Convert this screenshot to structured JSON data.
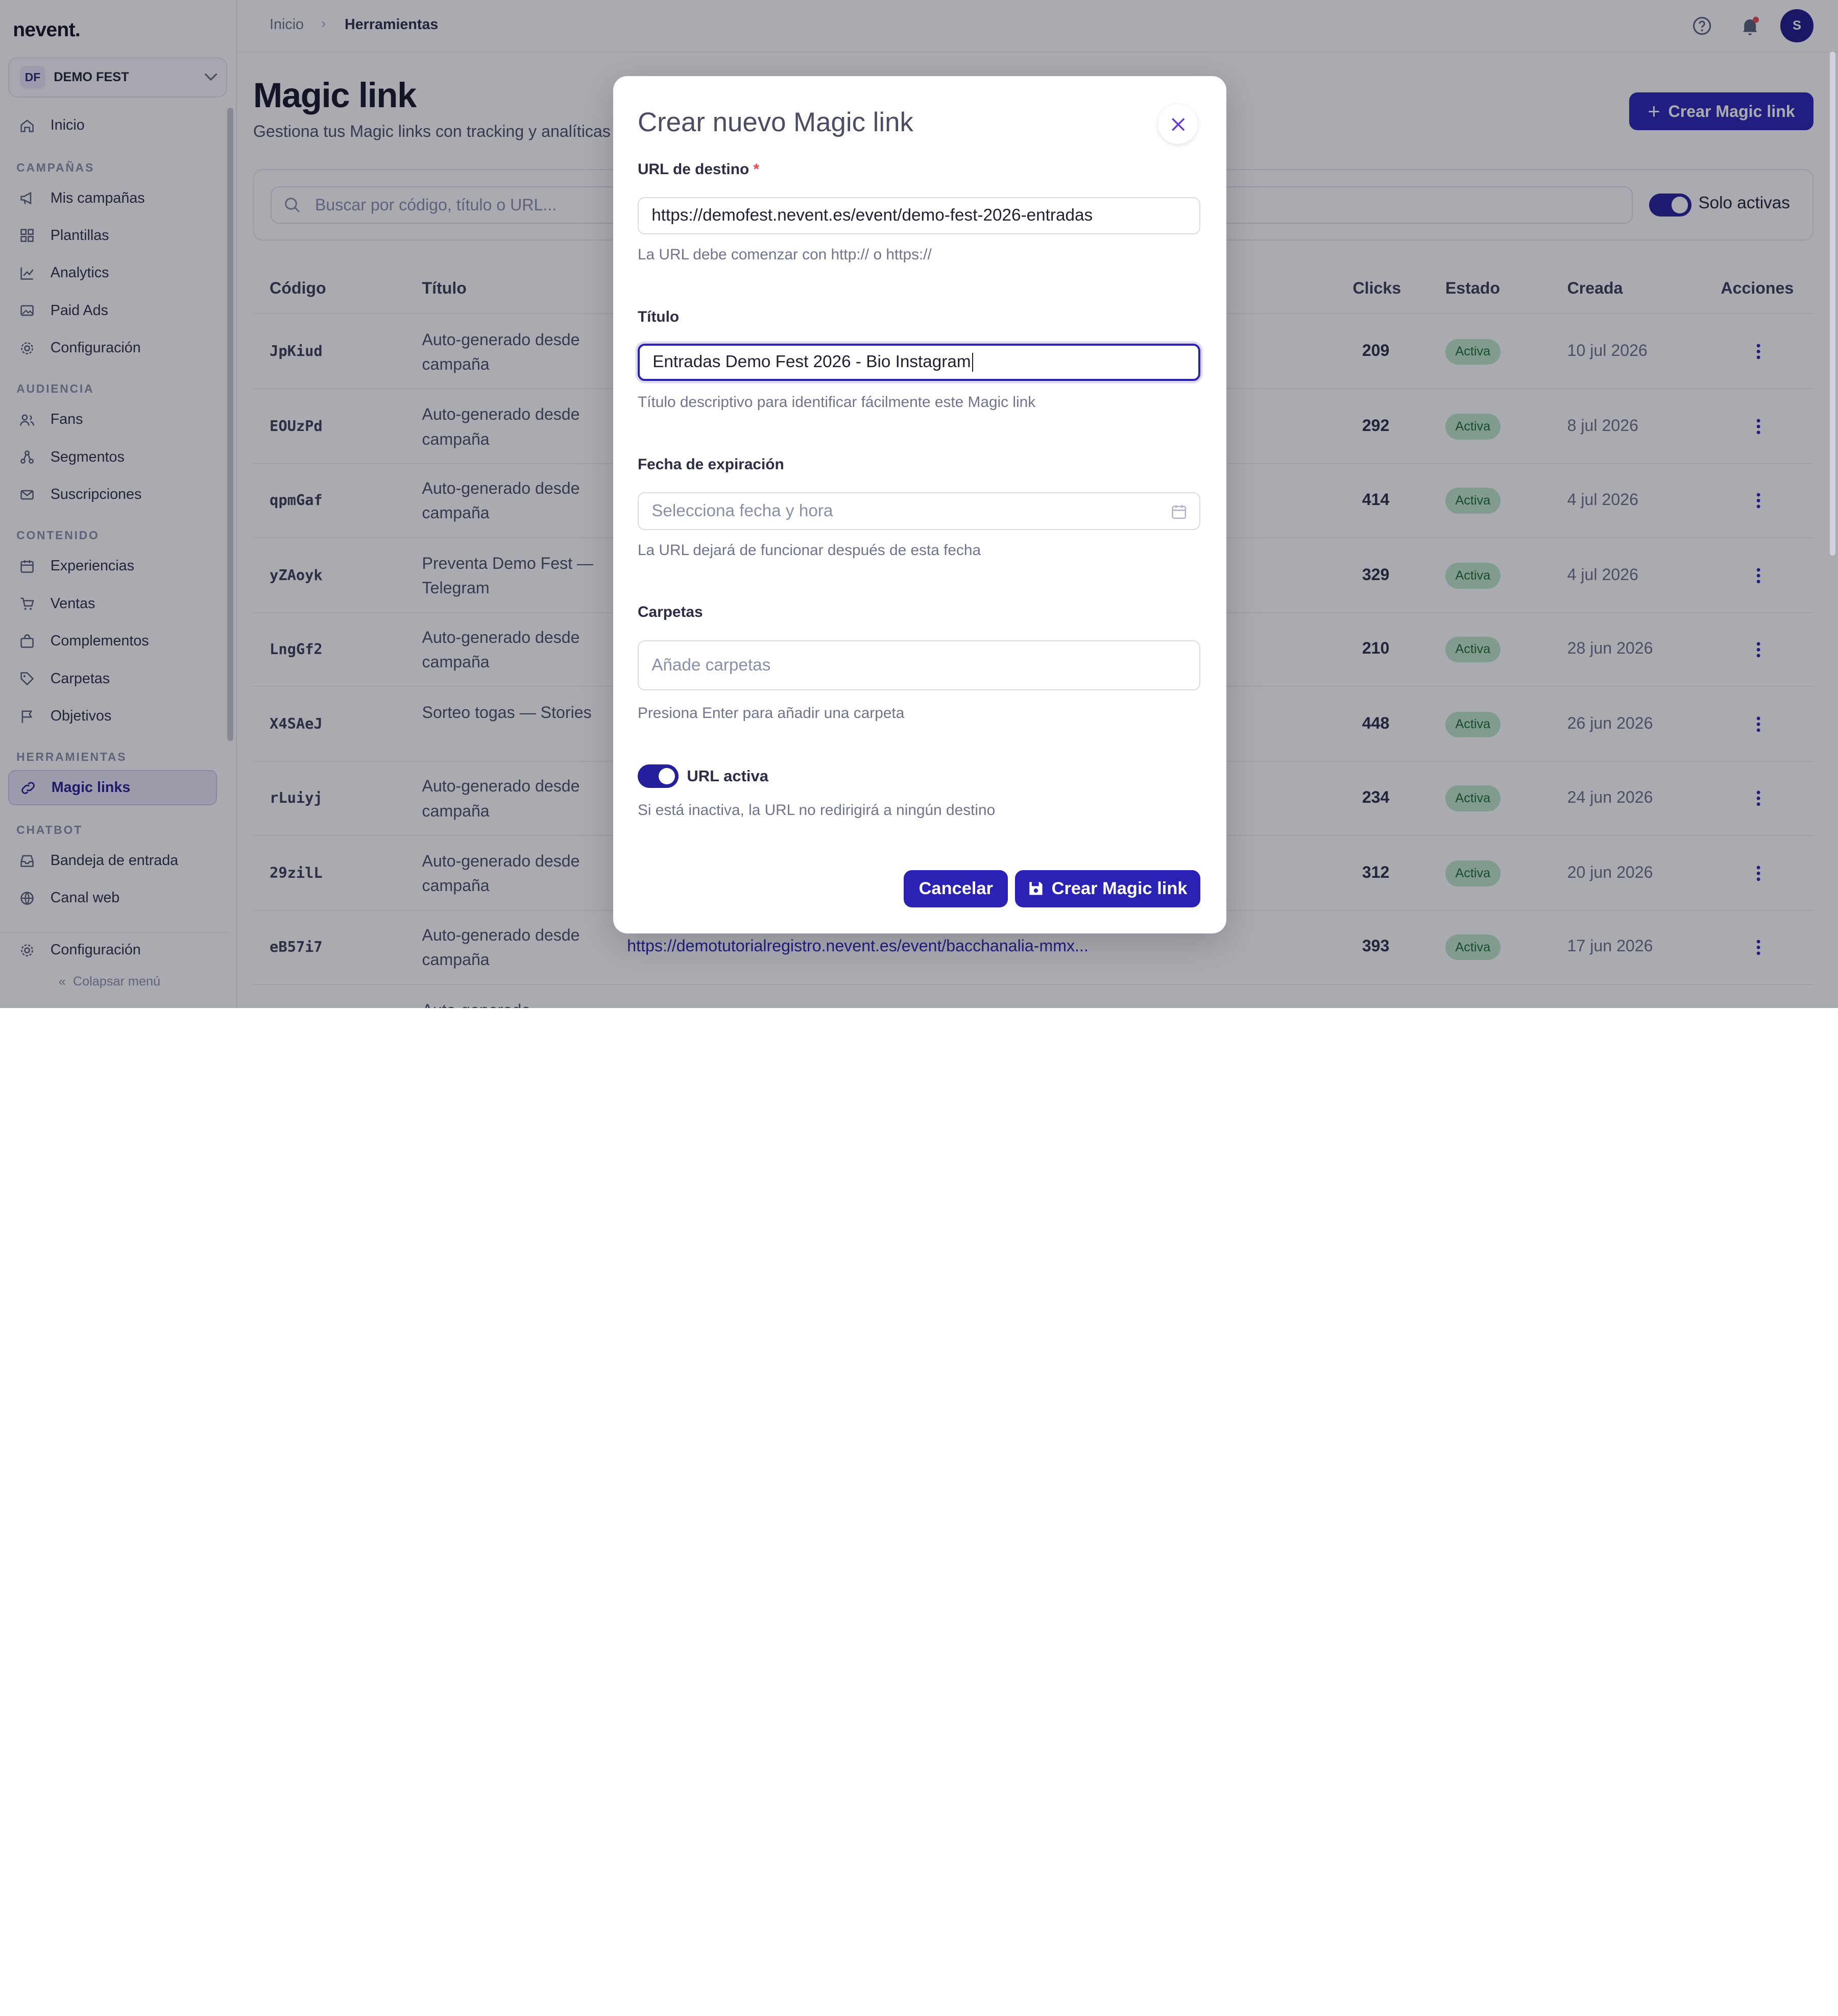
{
  "logo": "nevent.",
  "org": {
    "badge": "DF",
    "name": "DEMO FEST"
  },
  "sidebar": {
    "inicio": "Inicio",
    "sec_campanas": "CAMPAÑAS",
    "mis_campanas": "Mis campañas",
    "plantillas": "Plantillas",
    "analytics": "Analytics",
    "paid_ads": "Paid Ads",
    "configuracion": "Configuración",
    "sec_audiencia": "AUDIENCIA",
    "fans": "Fans",
    "segmentos": "Segmentos",
    "suscripciones": "Suscripciones",
    "sec_contenido": "CONTENIDO",
    "experiencias": "Experiencias",
    "ventas": "Ventas",
    "complementos": "Complementos",
    "carpetas": "Carpetas",
    "objetivos": "Objetivos",
    "sec_herramientas": "HERRAMIENTAS",
    "magic_links": "Magic links",
    "sec_chatbot": "CHATBOT",
    "bandeja": "Bandeja de entrada",
    "canal_web": "Canal web",
    "configuracion_bottom": "Configuración",
    "colapsar": "Colapsar menú"
  },
  "breadcrumb": {
    "home": "Inicio",
    "current": "Herramientas"
  },
  "avatar": "S",
  "page": {
    "title": "Magic link",
    "subtitle": "Gestiona tus Magic links con tracking y analíticas",
    "create_button": "Crear Magic link",
    "search_placeholder": "Buscar por código, título o URL...",
    "solo_activas": "Solo activas"
  },
  "table": {
    "headers": {
      "codigo": "Código",
      "titulo": "Título",
      "clicks": "Clicks",
      "estado": "Estado",
      "creada": "Creada",
      "acciones": "Acciones"
    },
    "rows": [
      {
        "code": "JpKiud",
        "title": "Auto-generado desde campaña",
        "url": "",
        "clicks": "209",
        "status": "Activa",
        "date": "10 jul 2026"
      },
      {
        "code": "EOUzPd",
        "title": "Auto-generado desde campaña",
        "url": "",
        "clicks": "292",
        "status": "Activa",
        "date": "8 jul 2026"
      },
      {
        "code": "qpmGaf",
        "title": "Auto-generado desde campaña",
        "url": "",
        "clicks": "414",
        "status": "Activa",
        "date": "4 jul 2026"
      },
      {
        "code": "yZAoyk",
        "title": "Preventa Demo Fest — Telegram",
        "url": "",
        "clicks": "329",
        "status": "Activa",
        "date": "4 jul 2026"
      },
      {
        "code": "LngGf2",
        "title": "Auto-generado desde campaña",
        "url": "",
        "clicks": "210",
        "status": "Activa",
        "date": "28 jun 2026"
      },
      {
        "code": "X4SAeJ",
        "title": "Sorteo togas — Stories",
        "url": "",
        "clicks": "448",
        "status": "Activa",
        "date": "26 jun 2026"
      },
      {
        "code": "rLuiyj",
        "title": "Auto-generado desde campaña",
        "url": "",
        "clicks": "234",
        "status": "Activa",
        "date": "24 jun 2026"
      },
      {
        "code": "29zilL",
        "title": "Auto-generado desde campaña",
        "url": "",
        "clicks": "312",
        "status": "Activa",
        "date": "20 jun 2026"
      },
      {
        "code": "eB57i7",
        "title": "Auto-generado desde campaña",
        "url": "https://demotutorialregistro.nevent.es/event/bacchanalia-mmx...",
        "clicks": "393",
        "status": "Activa",
        "date": "17 jun 2026"
      },
      {
        "code": "",
        "title": "Auto-generado",
        "url": "",
        "clicks": "",
        "status": "",
        "date": ""
      }
    ]
  },
  "modal": {
    "title": "Crear nuevo Magic link",
    "url_label": "URL de destino",
    "url_required": "*",
    "url_value": "https://demofest.nevent.es/event/demo-fest-2026-entradas",
    "url_help": "La URL debe comenzar con http:// o https://",
    "titulo_label": "Título",
    "titulo_value": "Entradas Demo Fest 2026 - Bio Instagram",
    "titulo_help": "Título descriptivo para identificar fácilmente este Magic link",
    "fecha_label": "Fecha de expiración",
    "fecha_placeholder": "Selecciona fecha y hora",
    "fecha_help": "La URL dejará de funcionar después de esta fecha",
    "carpetas_label": "Carpetas",
    "carpetas_placeholder": "Añade carpetas",
    "carpetas_help": "Presiona Enter para añadir una carpeta",
    "activa_label": "URL activa",
    "activa_help": "Si está inactiva, la URL no redirigirá a ningún destino",
    "cancel": "Cancelar",
    "submit": "Crear Magic link"
  },
  "colors": {
    "primary": "#2a22b5",
    "badge_bg": "#bfe6c9",
    "badge_text": "#1d6b34",
    "required": "#e5484d"
  }
}
